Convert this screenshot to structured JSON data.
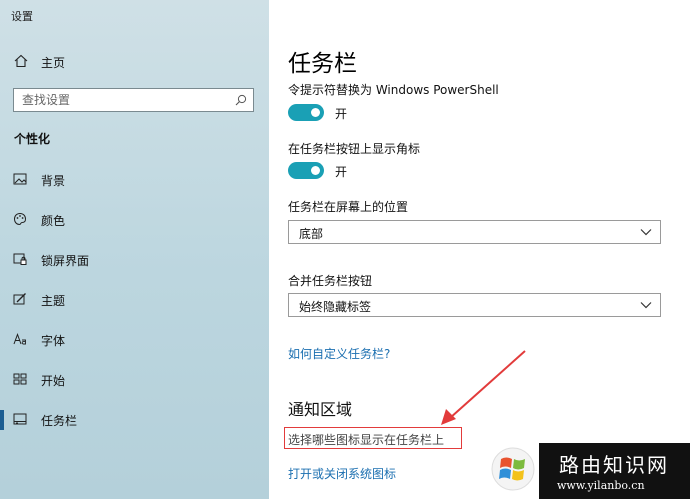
{
  "window": {
    "title": "设置"
  },
  "sidebar": {
    "home_label": "主页",
    "search_placeholder": "查找设置",
    "section": "个性化",
    "items": [
      {
        "label": "背景",
        "icon": "image-icon"
      },
      {
        "label": "颜色",
        "icon": "palette-icon"
      },
      {
        "label": "锁屏界面",
        "icon": "lock-screen-icon"
      },
      {
        "label": "主题",
        "icon": "theme-icon"
      },
      {
        "label": "字体",
        "icon": "font-icon"
      },
      {
        "label": "开始",
        "icon": "start-icon"
      },
      {
        "label": "任务栏",
        "icon": "taskbar-icon",
        "selected": true
      }
    ]
  },
  "main": {
    "title": "任务栏",
    "settings": [
      {
        "label": "令提示符替换为 Windows PowerShell",
        "state": "开"
      },
      {
        "label": "在任务栏按钮上显示角标",
        "state": "开"
      }
    ],
    "position_label": "任务栏在屏幕上的位置",
    "position_value": "底部",
    "combine_label": "合并任务栏按钮",
    "combine_value": "始终隐藏标签",
    "customize_link": "如何自定义任务栏?",
    "notification_heading": "通知区域",
    "select_icons_link": "选择哪些图标显示在任务栏上",
    "system_icons_link": "打开或关闭系统图标"
  },
  "watermark": {
    "text": "路由知识网",
    "url": "www.yilanbo.cn"
  },
  "colors": {
    "accent": "#1aa0b5",
    "link": "#1b6fb0",
    "annotation": "#e23b3b",
    "selected_bar": "#1b5e93"
  }
}
